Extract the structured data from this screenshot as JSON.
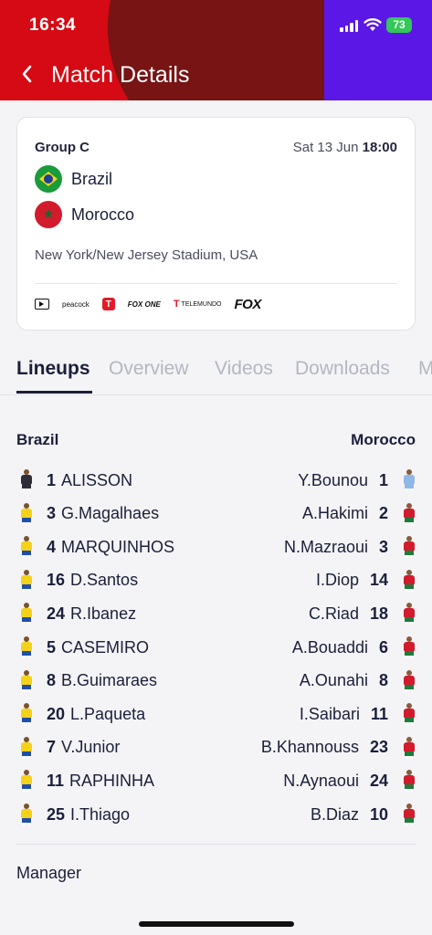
{
  "status_bar": {
    "time": "16:34",
    "battery": "73"
  },
  "header": {
    "title": "Match Details",
    "colors": {
      "red": "#d60a14",
      "dark_red": "#781414",
      "purple": "#5b17e6"
    }
  },
  "match": {
    "group": "Group C",
    "date": "Sat 13 Jun",
    "time": "18:00",
    "home_team": "Brazil",
    "away_team": "Morocco",
    "venue": "New York/New Jersey Stadium, USA",
    "broadcasters": [
      "tv-icon",
      "peacock",
      "T",
      "FOX ONE",
      "TELEMUNDO",
      "FOX"
    ]
  },
  "tabs": [
    {
      "label": "Lineups",
      "active": true
    },
    {
      "label": "Overview",
      "active": false
    },
    {
      "label": "Videos",
      "active": false
    },
    {
      "label": "Downloads",
      "active": false
    },
    {
      "label": "M",
      "active": false
    }
  ],
  "lineups": {
    "home_label": "Brazil",
    "away_label": "Morocco",
    "home": [
      {
        "number": "1",
        "name": "ALISSON",
        "kit": "goalkeeper"
      },
      {
        "number": "3",
        "name": "G.Magalhaes",
        "kit": "outfield"
      },
      {
        "number": "4",
        "name": "MARQUINHOS",
        "kit": "outfield"
      },
      {
        "number": "16",
        "name": "D.Santos",
        "kit": "outfield"
      },
      {
        "number": "24",
        "name": "R.Ibanez",
        "kit": "outfield"
      },
      {
        "number": "5",
        "name": "CASEMIRO",
        "kit": "outfield"
      },
      {
        "number": "8",
        "name": "B.Guimaraes",
        "kit": "outfield"
      },
      {
        "number": "20",
        "name": "L.Paqueta",
        "kit": "outfield"
      },
      {
        "number": "7",
        "name": "V.Junior",
        "kit": "outfield"
      },
      {
        "number": "11",
        "name": "RAPHINHA",
        "kit": "outfield"
      },
      {
        "number": "25",
        "name": "I.Thiago",
        "kit": "outfield"
      }
    ],
    "away": [
      {
        "number": "1",
        "name": "Y.Bounou",
        "kit": "goalkeeper"
      },
      {
        "number": "2",
        "name": "A.Hakimi",
        "kit": "outfield"
      },
      {
        "number": "3",
        "name": "N.Mazraoui",
        "kit": "outfield"
      },
      {
        "number": "14",
        "name": "I.Diop",
        "kit": "outfield"
      },
      {
        "number": "18",
        "name": "C.Riad",
        "kit": "outfield"
      },
      {
        "number": "6",
        "name": "A.Bouaddi",
        "kit": "outfield"
      },
      {
        "number": "8",
        "name": "A.Ounahi",
        "kit": "outfield"
      },
      {
        "number": "11",
        "name": "I.Saibari",
        "kit": "outfield"
      },
      {
        "number": "23",
        "name": "B.Khannouss",
        "kit": "outfield"
      },
      {
        "number": "24",
        "name": "N.Aynaoui",
        "kit": "outfield"
      },
      {
        "number": "10",
        "name": "B.Diaz",
        "kit": "outfield"
      }
    ],
    "manager_label": "Manager"
  }
}
